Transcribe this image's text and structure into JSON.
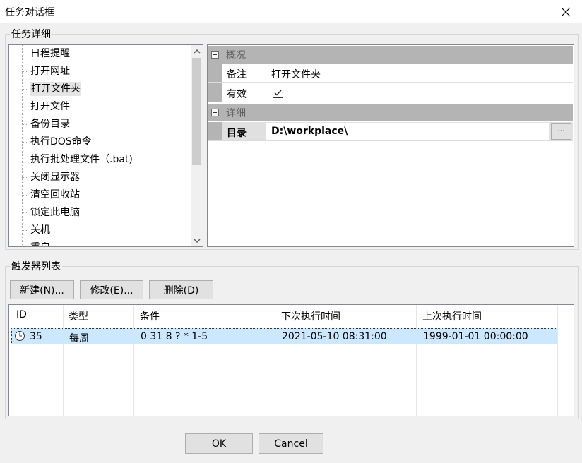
{
  "window": {
    "title": "任务对话框"
  },
  "task_detail": {
    "group_label": "任务详细",
    "tree_items": [
      "日程提醒",
      "打开网址",
      "打开文件夹",
      "打开文件",
      "备份目录",
      "执行DOS命令",
      "执行批处理文件（.bat)",
      "关闭显示器",
      "清空回收站",
      "锁定此电脑",
      "关机",
      "重启"
    ],
    "selected_item": "打开文件夹",
    "properties": {
      "overview_label": "概况",
      "note_name": "备注",
      "note_value": "打开文件夹",
      "enabled_name": "有效",
      "enabled_checked": true,
      "detail_label": "详细",
      "dir_name": "目录",
      "dir_value": "D:\\workplace\\",
      "browse_label": "..."
    }
  },
  "triggers": {
    "group_label": "触发器列表",
    "buttons": {
      "new": "新建(N)...",
      "edit": "修改(E)...",
      "delete": "删除(D)"
    },
    "columns": [
      "ID",
      "类型",
      "条件",
      "下次执行时间",
      "上次执行时间"
    ],
    "rows": [
      {
        "id": "35",
        "type": "每周",
        "condition": "0 31 8 ? * 1-5",
        "next_run": "2021-05-10 08:31:00",
        "last_run": "1999-01-01 00:00:00"
      }
    ]
  },
  "footer": {
    "ok": "OK",
    "cancel": "Cancel"
  }
}
